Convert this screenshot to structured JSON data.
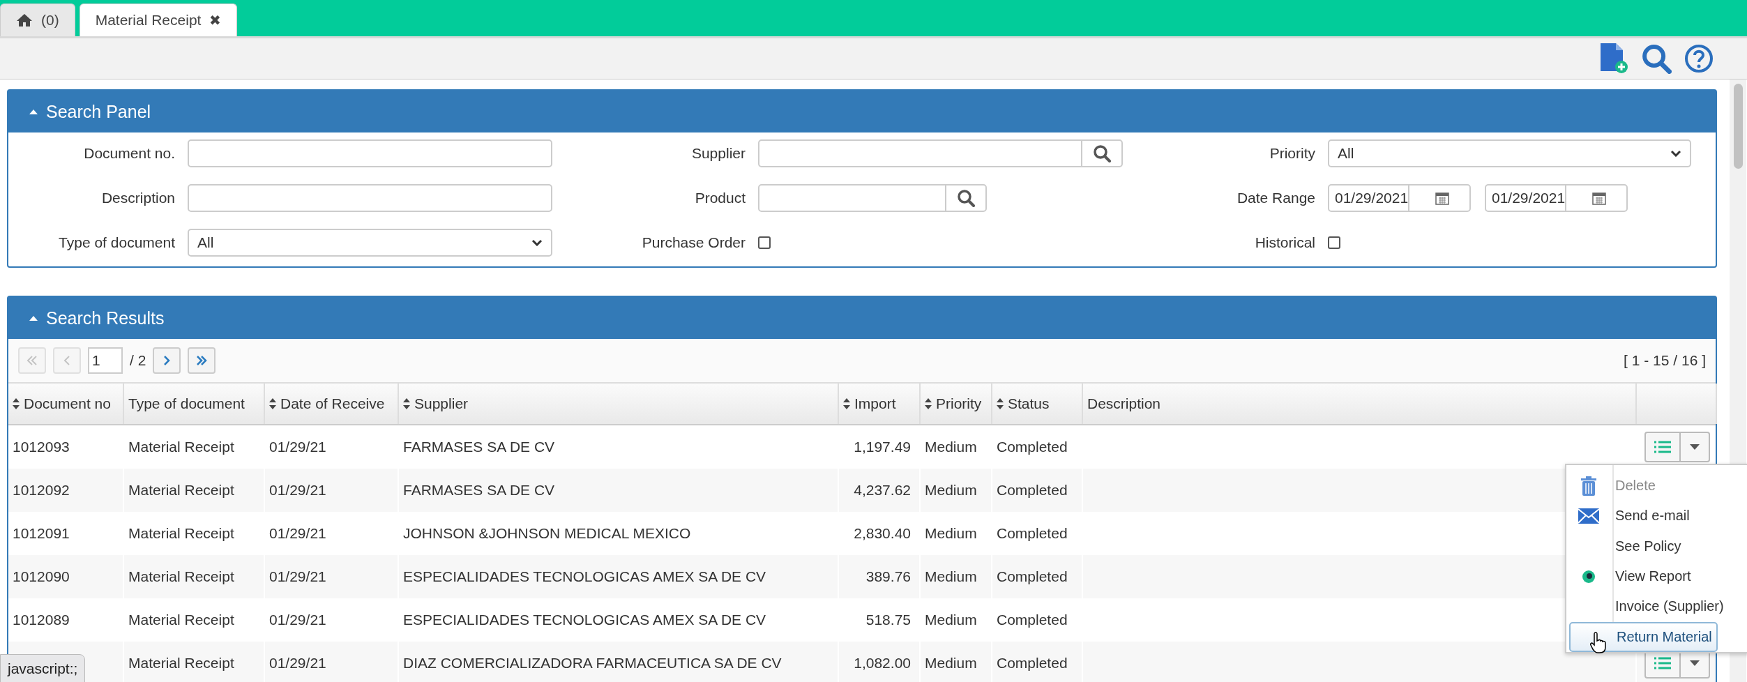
{
  "tabs": [
    {
      "kind": "home",
      "label": "(0)",
      "selected": false
    },
    {
      "kind": "page",
      "label": "Material Receipt",
      "close": "✖",
      "selected": true
    }
  ],
  "search_panel": {
    "title": "Search Panel",
    "expanded": true,
    "fields": [
      {
        "kind": "text",
        "label": "Document no."
      },
      {
        "kind": "lookup",
        "label": "Supplier",
        "wide": true
      },
      {
        "kind": "select",
        "label": "Priority",
        "value": "All"
      },
      {
        "kind": "text",
        "label": "Description"
      },
      {
        "kind": "lookup",
        "label": "Product",
        "wide": false
      },
      {
        "kind": "daterange",
        "label": "Date Range",
        "from": "01/29/2021",
        "to": "01/29/2021"
      },
      {
        "kind": "select",
        "label": "Type of document",
        "value": "All"
      },
      {
        "kind": "checkbox",
        "label": "Purchase Order",
        "checked": false
      },
      {
        "kind": "checkbox",
        "label": "Historical",
        "checked": false
      }
    ]
  },
  "results": {
    "title": "Search Results",
    "expanded": true,
    "pager": {
      "page": "1",
      "total": "/ 2",
      "range": "[ 1 - 15 / 16 ]",
      "first_disabled": true,
      "prev_disabled": true
    },
    "columns": [
      {
        "label": "Document no",
        "sortable": true
      },
      {
        "label": "Type of document",
        "sortable": false
      },
      {
        "label": "Date of Receive",
        "sortable": true
      },
      {
        "label": "Supplier",
        "sortable": true
      },
      {
        "label": "Import",
        "sortable": true
      },
      {
        "label": "Priority",
        "sortable": true
      },
      {
        "label": "Status",
        "sortable": true
      },
      {
        "label": "Description",
        "sortable": false
      }
    ],
    "rows": [
      {
        "doc": "1012093",
        "type": "Material Receipt",
        "date": "01/29/21",
        "supplier": "FARMASES SA DE CV",
        "import": "1,197.49",
        "priority": "Medium",
        "status": "Completed",
        "actions": true
      },
      {
        "doc": "1012092",
        "type": "Material Receipt",
        "date": "01/29/21",
        "supplier": "FARMASES SA DE CV",
        "import": "4,237.62",
        "priority": "Medium",
        "status": "Completed",
        "actions": false
      },
      {
        "doc": "1012091",
        "type": "Material Receipt",
        "date": "01/29/21",
        "supplier": "JOHNSON &JOHNSON MEDICAL MEXICO",
        "import": "2,830.40",
        "priority": "Medium",
        "status": "Completed",
        "actions": false
      },
      {
        "doc": "1012090",
        "type": "Material Receipt",
        "date": "01/29/21",
        "supplier": "ESPECIALIDADES TECNOLOGICAS AMEX SA DE CV",
        "import": "389.76",
        "priority": "Medium",
        "status": "Completed",
        "actions": false
      },
      {
        "doc": "1012089",
        "type": "Material Receipt",
        "date": "01/29/21",
        "supplier": "ESPECIALIDADES TECNOLOGICAS AMEX SA DE CV",
        "import": "518.75",
        "priority": "Medium",
        "status": "Completed",
        "actions": false
      },
      {
        "type": "Material Receipt",
        "date": "01/29/21",
        "supplier": "DIAZ COMERCIALIZADORA FARMACEUTICA SA DE CV",
        "import": "1,082.00",
        "priority": "Medium",
        "status": "Completed",
        "actions": true
      }
    ]
  },
  "action_menu": [
    {
      "kind": "trash",
      "label": "Delete",
      "disabled": true,
      "selected": false
    },
    {
      "kind": "envelope",
      "label": "Send e-mail",
      "disabled": false,
      "selected": false
    },
    {
      "kind": "plain",
      "label": "See Policy",
      "disabled": false,
      "selected": false
    },
    {
      "kind": "eye",
      "label": "View Report",
      "disabled": false,
      "selected": false
    },
    {
      "kind": "plain",
      "label": "Invoice (Supplier)",
      "disabled": false,
      "selected": false
    },
    {
      "kind": "plain",
      "label": "Return Material",
      "disabled": false,
      "selected": true
    }
  ],
  "status_tooltip": "javascript:;"
}
